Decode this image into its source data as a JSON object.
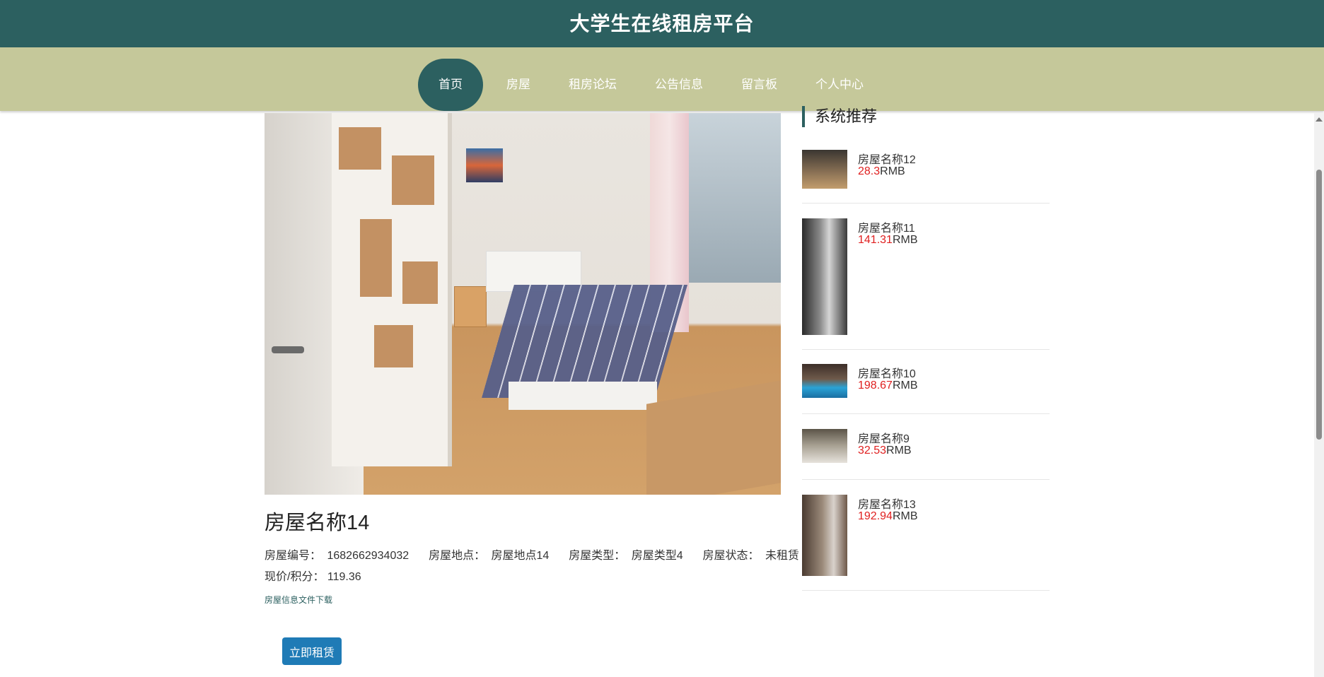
{
  "header": {
    "site_title": "大学生在线租房平台"
  },
  "nav": {
    "items": [
      {
        "label": "首页",
        "active": true
      },
      {
        "label": "房屋",
        "active": false
      },
      {
        "label": "租房论坛",
        "active": false
      },
      {
        "label": "公告信息",
        "active": false
      },
      {
        "label": "留言板",
        "active": false
      },
      {
        "label": "个人中心",
        "active": false
      }
    ]
  },
  "house": {
    "name": "房屋名称14",
    "fields": [
      {
        "label": "房屋编号：",
        "value": "1682662934032"
      },
      {
        "label": "房屋地点：",
        "value": "房屋地点14"
      },
      {
        "label": "房屋类型：",
        "value": "房屋类型4"
      },
      {
        "label": "房屋状态：",
        "value": "未租赁"
      }
    ],
    "price_label": "现价/积分：",
    "price_value": "119.36",
    "download_link": "房屋信息文件下载",
    "rent_button": "立即租赁"
  },
  "sidebar": {
    "title": "系统推荐",
    "items": [
      {
        "name": "房屋名称12",
        "price": "28.3",
        "unit": "RMB"
      },
      {
        "name": "房屋名称11",
        "price": "141.31",
        "unit": "RMB"
      },
      {
        "name": "房屋名称10",
        "price": "198.67",
        "unit": "RMB"
      },
      {
        "name": "房屋名称9",
        "price": "32.53",
        "unit": "RMB"
      },
      {
        "name": "房屋名称13",
        "price": "192.94",
        "unit": "RMB"
      }
    ]
  },
  "colors": {
    "header_bg": "#2c6060",
    "nav_bg": "#c5c89a",
    "price_red": "#e02020",
    "button_blue": "#1f7bb6"
  }
}
